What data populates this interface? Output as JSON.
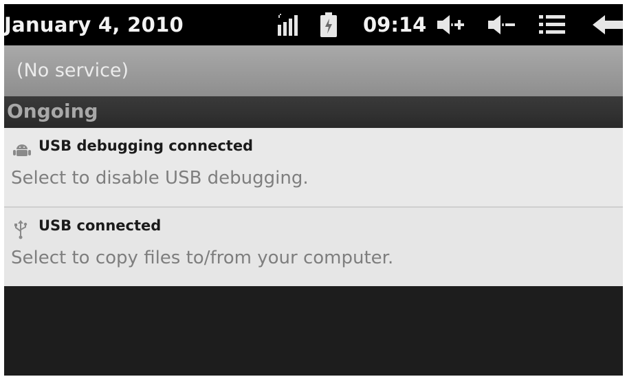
{
  "status_bar": {
    "date": "January 4, 2010",
    "time": "09:14",
    "icons": [
      "signal-icon",
      "battery-icon",
      "volume-up-icon",
      "volume-down-icon",
      "menu-icon",
      "back-icon"
    ]
  },
  "carrier": {
    "text": "(No service)"
  },
  "notifications": {
    "section_title": "Ongoing",
    "items": [
      {
        "icon": "android-debug-icon",
        "title": "USB debugging connected",
        "text": "Select to disable USB debugging."
      },
      {
        "icon": "usb-icon",
        "title": "USB connected",
        "text": "Select to copy files to/from your computer."
      }
    ]
  },
  "colors": {
    "status_bar_bg": "#000000",
    "carrier_bar_bg": "#9c9c9c",
    "section_bg": "#2f2f2f",
    "notification_bg": "#e8e8e8",
    "title_text": "#1b1b1b",
    "body_text": "#7e7e7e"
  }
}
